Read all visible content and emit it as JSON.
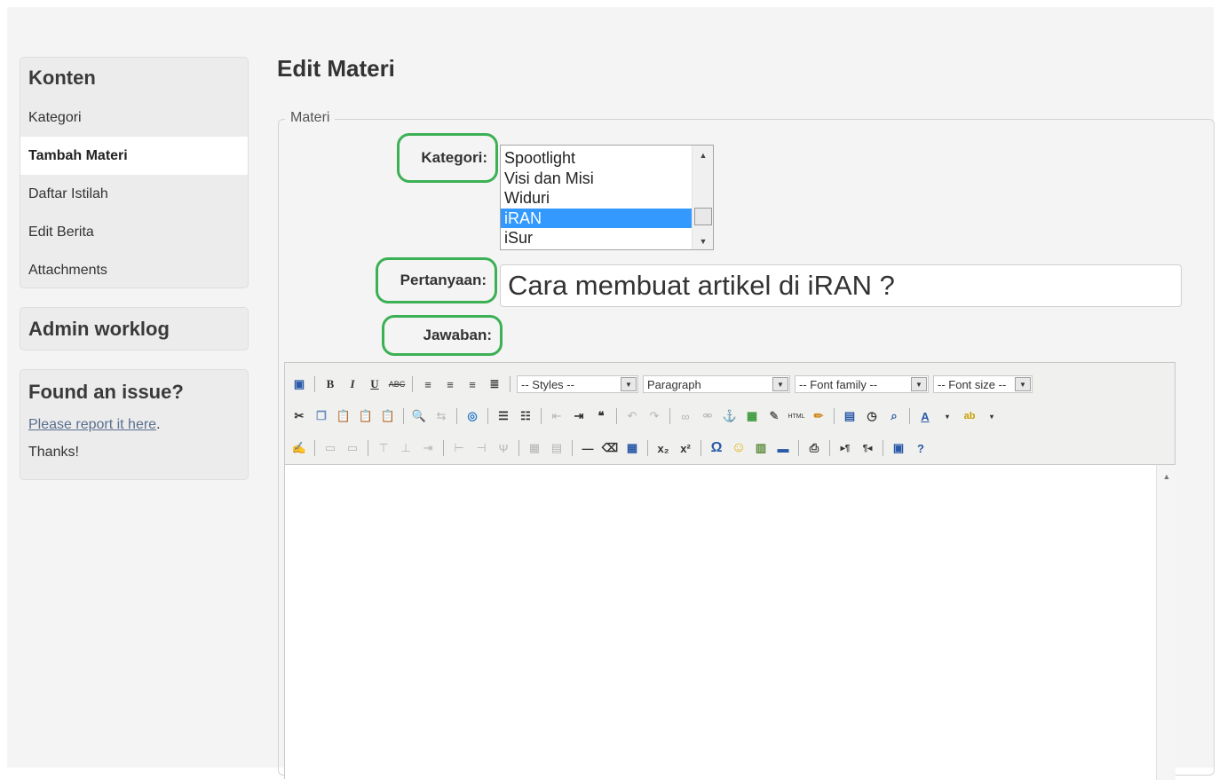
{
  "sidebar": {
    "konten": {
      "title": "Konten",
      "items": [
        {
          "label": "Kategori",
          "active": false
        },
        {
          "label": "Tambah Materi",
          "active": true
        },
        {
          "label": "Daftar Istilah",
          "active": false
        },
        {
          "label": "Edit Berita",
          "active": false
        },
        {
          "label": "Attachments",
          "active": false
        }
      ]
    },
    "worklog": {
      "title": "Admin worklog"
    },
    "issue": {
      "title": "Found an issue?",
      "link": "Please report it here",
      "after_link": ".",
      "thanks": "Thanks!"
    }
  },
  "main": {
    "title": "Edit Materi",
    "fieldset_legend": "Materi",
    "kategori": {
      "label": "Kategori:",
      "options": [
        "Spootlight",
        "Visi dan Misi",
        "Widuri",
        "iRAN",
        "iSur"
      ],
      "selected": "iRAN"
    },
    "pertanyaan": {
      "label": "Pertanyaan:",
      "value": "Cara membuat artikel di iRAN ?"
    },
    "jawaban": {
      "label": "Jawaban:"
    }
  },
  "editor": {
    "styles_dropdown": "-- Styles --",
    "format_dropdown": "Paragraph",
    "font_family_dropdown": "-- Font family --",
    "font_size_dropdown": "-- Font size --",
    "bold": "B",
    "italic": "I",
    "underline": "U",
    "strikethrough": "ABC",
    "html_button": "HTML",
    "subscript": "x₂",
    "superscript": "x²",
    "omega": "Ω"
  },
  "colors": {
    "highlight_border": "#3cb054",
    "selected_option": "#3399ff",
    "link": "#5a6e8e"
  }
}
